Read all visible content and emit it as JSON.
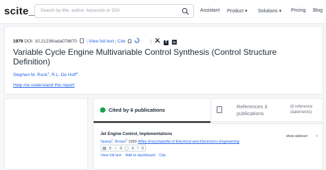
{
  "header": {
    "logo": "scite_",
    "search_placeholder": "Search by title, author, keywords or DOI",
    "nav": [
      "Assistant",
      "Product ▾",
      "Solutions ▾",
      "Pricing",
      "Blog"
    ]
  },
  "paper": {
    "year": "1979",
    "doi": "DOI: 10.21236/ada078670",
    "view_full_text": "View full text",
    "cite": "Cite",
    "title": "Variable Cycle Engine Multivariable Control Synthesis (Control Structure Definition)",
    "authors": [
      "Stephen M. Rock",
      "R.L. De Hoff"
    ],
    "author_sups": [
      "1",
      "2"
    ],
    "help_link": "Help me understand this report"
  },
  "tabs": {
    "cited_by": "Cited by 6 publications",
    "references_line1": "References 3",
    "references_line2": "publications",
    "ref_statements_line1": "(6 reference",
    "ref_statements_line2": "statements)"
  },
  "result": {
    "title": "Jet Engine Control, Implementations",
    "authors": [
      "Spang",
      "Brown"
    ],
    "author_sups": [
      "1",
      "2"
    ],
    "year": "1999",
    "journal": "Wiley Encyclopedia of Electrical and Electronics Engineering",
    "show_abstract": "show abstract",
    "badges": [
      "0",
      "0",
      "0",
      "0"
    ],
    "actions": [
      "View full text",
      "Add to dashboard",
      "Cite"
    ]
  },
  "colors": {
    "link": "#2563eb",
    "tab_active": "#111111",
    "check": "#16a34a",
    "cross": "#dc2626"
  }
}
